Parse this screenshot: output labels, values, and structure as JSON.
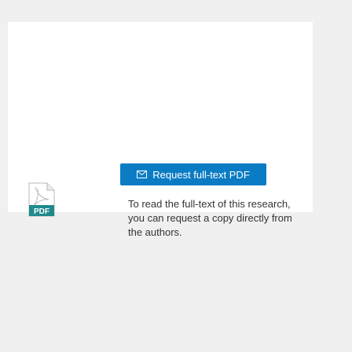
{
  "colors": {
    "page_background": "#f0f0f0",
    "card_background": "#ffffff",
    "button_background": "#0b7cc4",
    "button_text": "#ffffff",
    "description_text": "#333333",
    "pdf_badge": "#1f8a8d"
  },
  "pdf_icon": {
    "icon": "pdf-file-icon",
    "badge_label": "PDF"
  },
  "request_button": {
    "icon": "envelope-icon",
    "label": "Request full-text PDF"
  },
  "description": {
    "text": "To read the full-text of this research, you can request a copy directly from the authors."
  }
}
